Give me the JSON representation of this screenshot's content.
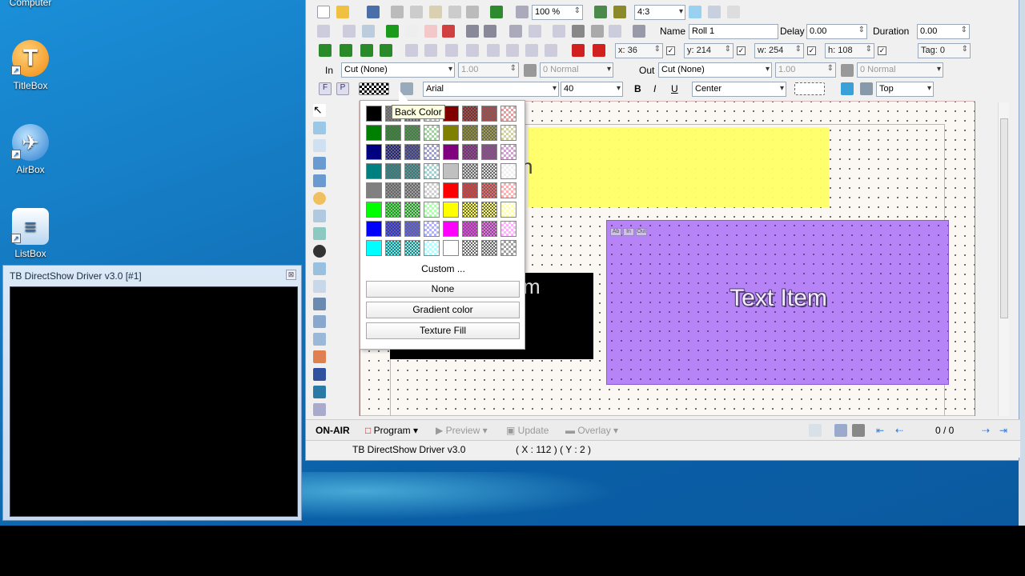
{
  "desktop": {
    "top_partial_label": "Computer",
    "icons": [
      {
        "label": "TitleBox",
        "color": "#f5a623",
        "glyph": "T"
      },
      {
        "label": "AirBox",
        "color": "#3a8fd8",
        "glyph": "✈"
      },
      {
        "label": "ListBox",
        "color": "#cfe3f5",
        "glyph": "≡"
      }
    ]
  },
  "driver_window": {
    "title": "TB DirectShow Driver v3.0 [#1]",
    "close": "⊠"
  },
  "toolbar1": {
    "zoom": "100 %",
    "aspect": "4:3"
  },
  "toolbar2": {
    "name_label": "Name",
    "name_value": "Roll 1",
    "delay_label": "Delay",
    "delay_value": "0.00",
    "duration_label": "Duration",
    "duration_value": "0.00"
  },
  "toolbar3": {
    "x": "x: 36",
    "y": "y: 214",
    "w": "w: 254",
    "h": "h: 108",
    "tag": "Tag: 0"
  },
  "toolbar4": {
    "in_label": "In",
    "in_value": "Cut (None)",
    "in_speed": "1.00",
    "in_mode": "0 Normal",
    "out_label": "Out",
    "out_value": "Cut (None)",
    "out_speed": "1.00",
    "out_mode": "0 Normal"
  },
  "toolbar5": {
    "f_btn": "F",
    "p_btn": "P",
    "font": "Arial",
    "size": "40",
    "bold": "B",
    "italic": "I",
    "underline": "U",
    "align": "Center",
    "valign": "Top"
  },
  "canvas": {
    "purple_text": "Text Item",
    "partial_yellow": "n",
    "partial_black": "m",
    "mini_tags": [
      "Ab",
      "In",
      "Out"
    ]
  },
  "color_popup": {
    "tooltip": "Back Color",
    "custom": "Custom ...",
    "none": "None",
    "gradient": "Gradient color",
    "texture": "Texture Fill",
    "colors": [
      "#000000",
      "#808080",
      "#a0a0a0",
      "#c0c0c0",
      "#800000",
      "#a02020",
      "#c04040",
      "#e0a0a0",
      "#008000",
      "#209020",
      "#40a040",
      "#a0d0a0",
      "#808000",
      "#909020",
      "#a0a040",
      "#d0d0a0",
      "#000080",
      "#202090",
      "#4040a0",
      "#a0a0d0",
      "#800080",
      "#902090",
      "#a040a0",
      "#d0a0d0",
      "#008080",
      "#209090",
      "#40a0a0",
      "#a0d0d0",
      "#c0c0c0",
      "#d0d0d0",
      "#e0e0e0",
      "#f0f0f0",
      "#808080",
      "#909090",
      "#a0a0a0",
      "#d0d0d0",
      "#ff0000",
      "#ff3030",
      "#ff6060",
      "#ffb0b0",
      "#00ff00",
      "#30ff30",
      "#60ff60",
      "#b0ffb0",
      "#ffff00",
      "#ffff30",
      "#ffff60",
      "#ffffb0",
      "#0000ff",
      "#3030ff",
      "#6060ff",
      "#b0b0ff",
      "#ff00ff",
      "#ff30ff",
      "#ff60ff",
      "#ffb0ff",
      "#00ffff",
      "#30ffff",
      "#60ffff",
      "#b0ffff",
      "#ffffff",
      "#f0f0f0",
      "#e0e0e0",
      "#a0a0a0"
    ]
  },
  "bottom_bar": {
    "on_air": "ON-AIR",
    "program": "Program",
    "preview": "Preview",
    "update": "Update",
    "overlay": "Overlay",
    "counter": "0 / 0"
  },
  "status_bar": {
    "driver": "TB DirectShow Driver v3.0",
    "coords": "( X : 112 )  ( Y : 2 )"
  }
}
